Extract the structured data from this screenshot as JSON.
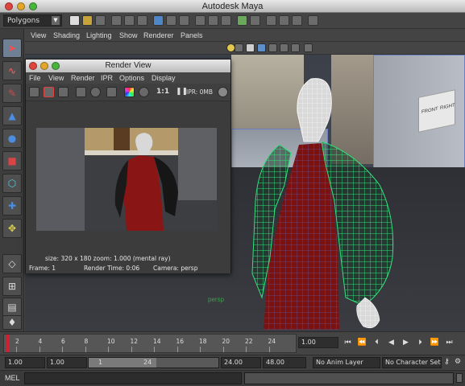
{
  "app": {
    "title": "Autodesk Maya"
  },
  "status_line": {
    "mode": "Polygons"
  },
  "viewport": {
    "menus": [
      "View",
      "Shading",
      "Lighting",
      "Show",
      "Renderer",
      "Panels"
    ],
    "camera_label": "persp",
    "viewcube": {
      "front": "FRONT",
      "right": "RIGHT"
    }
  },
  "render_view": {
    "title": "Render View",
    "menus": [
      "File",
      "View",
      "Render",
      "IPR",
      "Options",
      "Display"
    ],
    "ratio": "1:1",
    "ipr_status": "IPR: 0MB",
    "size_info": "size: 320 x 180  zoom: 1.000      (mental ray)",
    "frame": "Frame: 1",
    "render_time": "Render Time: 0:06",
    "camera": "Camera: persp"
  },
  "time_slider": {
    "ticks": [
      "2",
      "4",
      "6",
      "8",
      "10",
      "12",
      "14",
      "16",
      "18",
      "20",
      "22",
      "24"
    ],
    "current_frame": "1.00",
    "playback_glyphs": [
      "⏮",
      "⏪",
      "⏴",
      "◀",
      "▶",
      "⏵",
      "⏩",
      "⏭"
    ]
  },
  "range_slider": {
    "start_time": "1.00",
    "playback_start": "1.00",
    "range_start": "1",
    "range_end": "24",
    "playback_end": "24.00",
    "end_time": "48.00",
    "anim_layer": "No Anim Layer",
    "character_set": "No Character Set"
  },
  "command_line": {
    "label": "MEL"
  },
  "colors": {
    "wireframe_green": "#31e07a",
    "wireframe_white": "#ffffff",
    "dress_red": "#7a1212",
    "selection_blue": "#5c6fd1"
  }
}
